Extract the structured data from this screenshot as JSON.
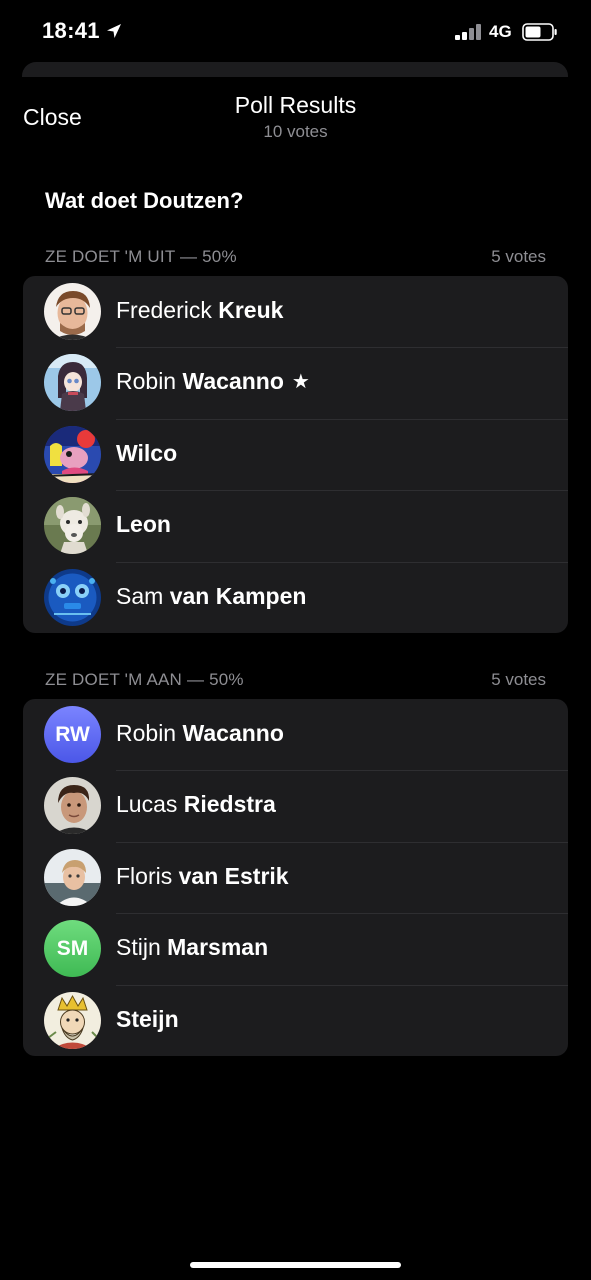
{
  "status_bar": {
    "time": "18:41",
    "network": "4G"
  },
  "nav": {
    "close_label": "Close",
    "title": "Poll Results",
    "subtitle": "10 votes"
  },
  "question": "Wat doet Doutzen?",
  "sections": [
    {
      "label": "ZE DOET 'M UIT — 50%",
      "count": "5 votes",
      "voters": [
        {
          "first": "Frederick",
          "last": "Kreuk",
          "avatar": "photo"
        },
        {
          "first": "Robin",
          "last": "Wacanno",
          "avatar": "cartoon",
          "badge": "star-icon"
        },
        {
          "first": "",
          "last": "Wilco",
          "avatar": "drawing"
        },
        {
          "first": "",
          "last": "Leon",
          "avatar": "alpaca-photo"
        },
        {
          "first": "Sam",
          "last": "van Kampen",
          "avatar": "blue-figure"
        }
      ]
    },
    {
      "label": "ZE DOET 'M AAN — 50%",
      "count": "5 votes",
      "voters": [
        {
          "first": "Robin",
          "last": "Wacanno",
          "avatar": "initials",
          "initials": "RW",
          "color": "#5b67f0"
        },
        {
          "first": "Lucas",
          "last": "Riedstra",
          "avatar": "photo"
        },
        {
          "first": "Floris",
          "last": "van Estrik",
          "avatar": "photo"
        },
        {
          "first": "Stijn",
          "last": "Marsman",
          "avatar": "initials",
          "initials": "SM",
          "color": "#4cc763"
        },
        {
          "first": "",
          "last": "Steijn",
          "avatar": "king-drawing"
        }
      ]
    }
  ],
  "colors": {
    "background": "#000000",
    "cell": "#1c1c1e",
    "secondary_text": "#8e8e93"
  }
}
